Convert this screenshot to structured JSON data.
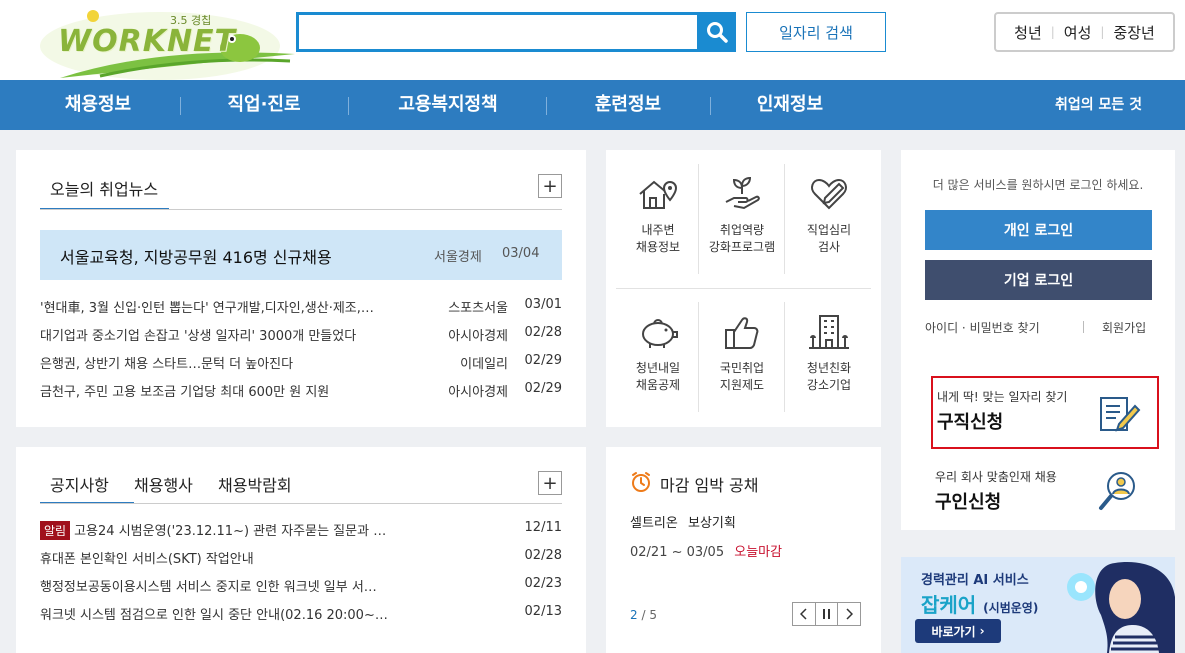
{
  "header": {
    "logo_version": "3.5 경칩",
    "logo_name": "WORKNET",
    "search_placeholder": "",
    "job_search_label": "일자리 검색",
    "targets": [
      "청년",
      "여성",
      "중장년"
    ]
  },
  "nav": {
    "items": [
      "채용정보",
      "직업·진로",
      "고용복지정책",
      "훈련정보",
      "인재정보"
    ],
    "right": "취업의 모든 것"
  },
  "news": {
    "tab": "오늘의 취업뉴스",
    "plus": "+",
    "highlight": {
      "title": "서울교육청, 지방공무원 416명 신규채용",
      "source": "서울경제",
      "date": "03/04"
    },
    "items": [
      {
        "title": "'현대車, 3월 신입·인턴 뽑는다' 연구개발,디자인,생산·제조,…",
        "source": "스포츠서울",
        "date": "03/01"
      },
      {
        "title": "대기업과 중소기업 손잡고 '상생 일자리' 3000개 만들었다",
        "source": "아시아경제",
        "date": "02/28"
      },
      {
        "title": "은행권, 상반기 채용 스타트…문턱 더 높아진다",
        "source": "이데일리",
        "date": "02/29"
      },
      {
        "title": "금천구, 주민 고용 보조금 기업당 최대 600만 원 지원",
        "source": "아시아경제",
        "date": "02/29"
      }
    ]
  },
  "notice": {
    "tabs": [
      "공지사항",
      "채용행사",
      "채용박람회"
    ],
    "plus": "+",
    "badge": "알림",
    "items": [
      {
        "title": "고용24 시범운영('23.12.11~) 관련 자주묻는 질문과 …",
        "date": "12/11"
      },
      {
        "title": "휴대폰 본인확인 서비스(SKT) 작업안내",
        "date": "02/28"
      },
      {
        "title": "행정정보공동이용시스템 서비스 중지로 인한 워크넷 일부 서…",
        "date": "02/23"
      },
      {
        "title": "워크넷 시스템 점검으로 인한 일시 중단 안내(02.16 20:00~…",
        "date": "02/13"
      }
    ]
  },
  "services": [
    {
      "l1": "내주변",
      "l2": "채용정보",
      "icon": "house-location-icon"
    },
    {
      "l1": "취업역량",
      "l2": "강화프로그램",
      "icon": "hand-sprout-icon"
    },
    {
      "l1": "직업심리",
      "l2": "검사",
      "icon": "heart-pen-icon"
    },
    {
      "l1": "청년내일",
      "l2": "채움공제",
      "icon": "piggy-bank-icon"
    },
    {
      "l1": "국민취업",
      "l2": "지원제도",
      "icon": "thumbs-up-icon"
    },
    {
      "l1": "청년친화",
      "l2": "강소기업",
      "icon": "building-icon"
    }
  ],
  "deadline": {
    "title": "마감 임박 공채",
    "company": "셀트리온",
    "job": "보상기획",
    "period": "02/21 ~ 03/05",
    "status": "오늘마감",
    "page_current": "2",
    "page_sep": "/",
    "page_total": "5"
  },
  "login": {
    "message": "더 많은 서비스를 원하시면 로그인 하세요.",
    "personal": "개인 로그인",
    "company": "기업 로그인",
    "find": "아이디 · 비밀번호 찾기",
    "join": "회원가입"
  },
  "job_request": {
    "sub": "내게 딱! 맞는 일자리 찾기",
    "title": "구직신청"
  },
  "talent_request": {
    "sub": "우리 회사 맞춤인재 채용",
    "title": "구인신청"
  },
  "ad": {
    "line1": "경력관리 AI 서비스",
    "brand": "잡케어",
    "suffix": "(시범운영)",
    "go": "바로가기"
  },
  "colors": {
    "nav": "#2d7cc0",
    "accent": "#1a8bd1",
    "highlight_bg": "#cfe6f7",
    "login_personal": "#3385c9",
    "login_company": "#3f4e6e",
    "red_outline": "#d9101c",
    "deadline_red": "#c8102e"
  }
}
